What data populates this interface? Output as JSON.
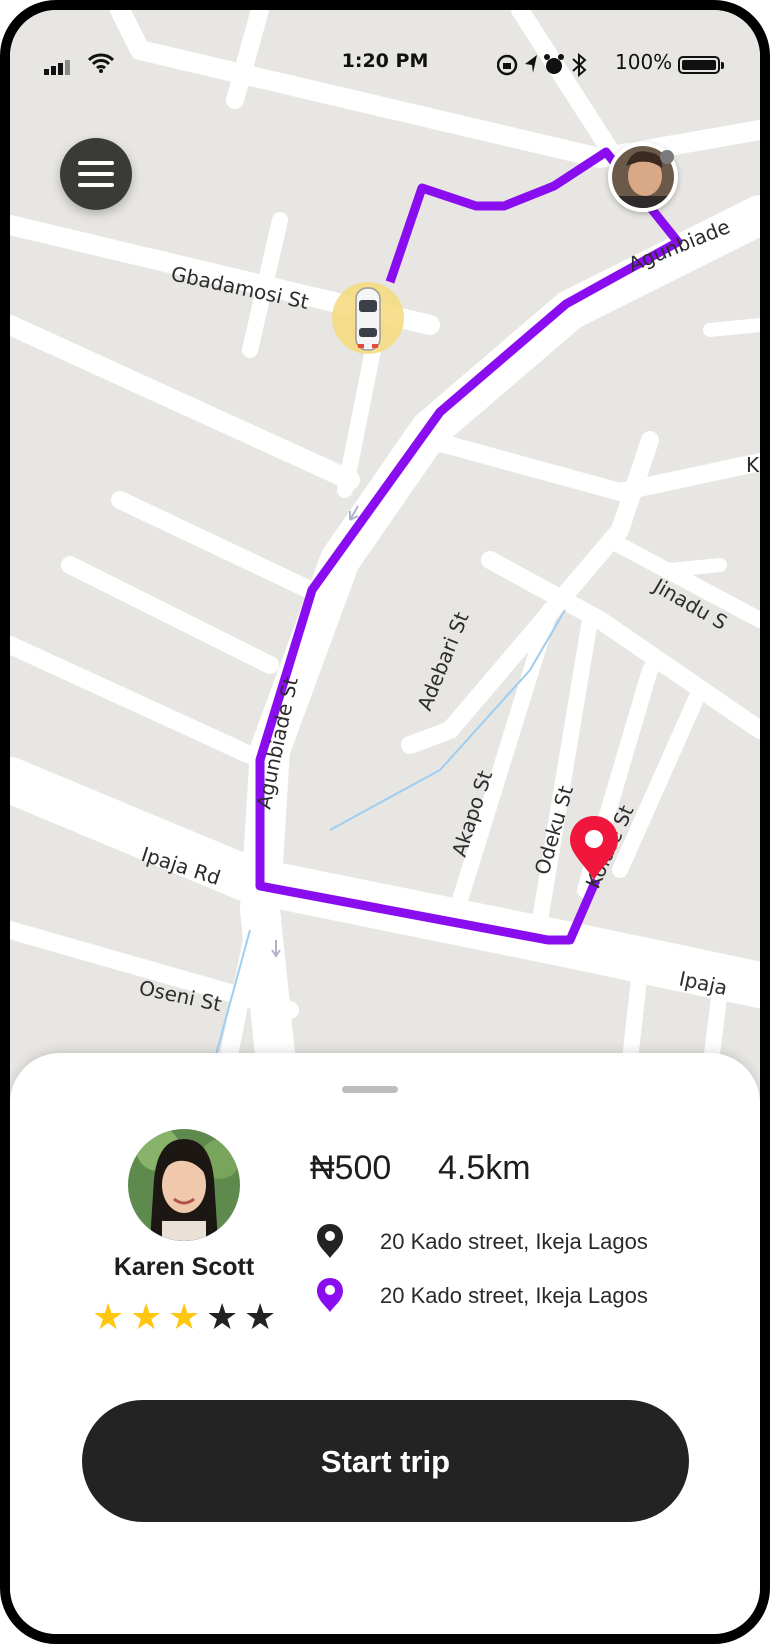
{
  "status_bar": {
    "time": "1:20 PM",
    "battery_percent": "100%",
    "icons": [
      "cellular-signal-icon",
      "wifi-icon",
      "orientation-lock-icon",
      "location-arrow-icon",
      "alarm-icon",
      "bluetooth-icon",
      "battery-icon"
    ]
  },
  "map": {
    "street_labels": [
      "Gbadamosi St",
      "Agunbiade",
      "Agunbiade St",
      "Adebari St",
      "Jinadu S",
      "Ipaja Rd",
      "Ipaja",
      "Oseni St",
      "Akapo St",
      "Odeku St",
      "Kolafe St",
      "K"
    ],
    "route_color": "#8a0df0",
    "destination_marker_color": "#f0163c"
  },
  "trip": {
    "driver_name": "Karen Scott",
    "rating": 3,
    "rating_max": 5,
    "price": "₦500",
    "distance": "4.5km",
    "pickup_address": "20 Kado street, Ikeja Lagos",
    "dropoff_address": "20 Kado street, Ikeja Lagos",
    "start_button_label": "Start trip"
  },
  "colors": {
    "accent": "#8a0df0",
    "star_filled": "#ffc70f",
    "star_empty": "#232323",
    "button_bg": "#232323"
  }
}
